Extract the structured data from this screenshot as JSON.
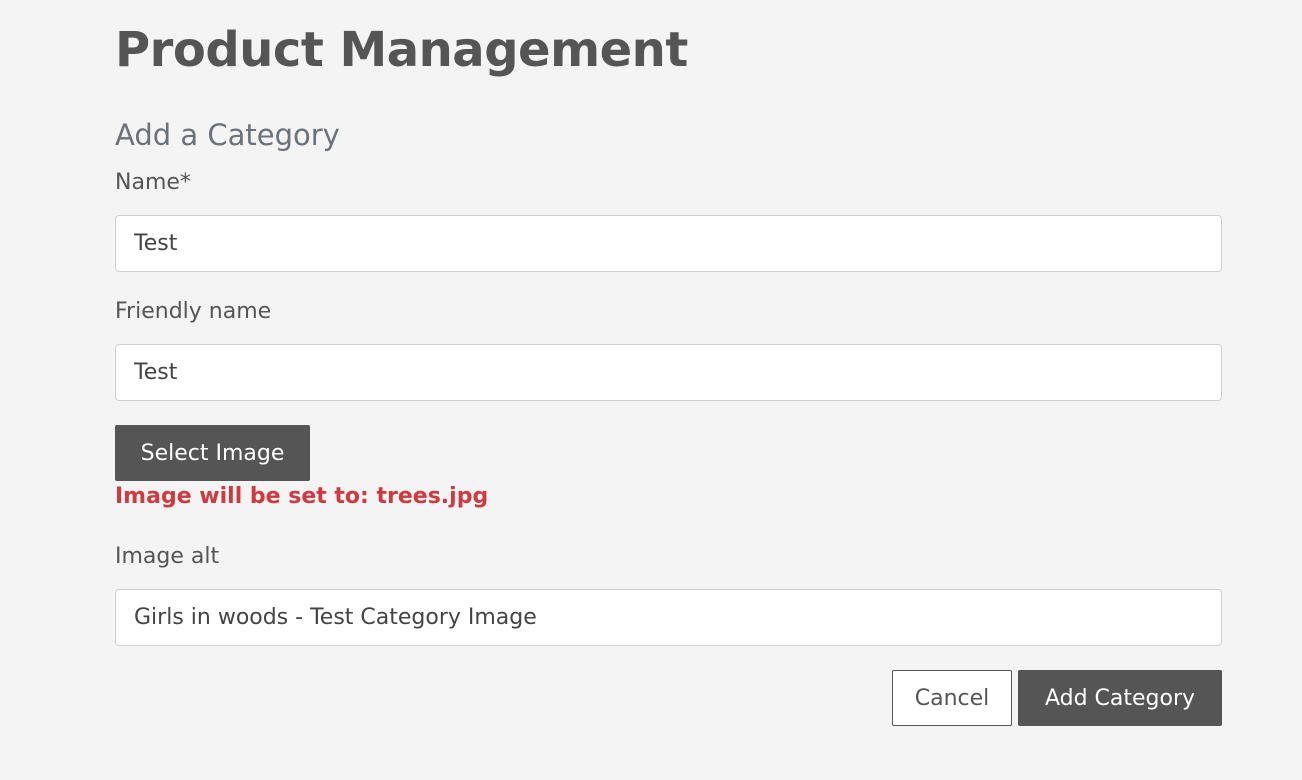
{
  "page": {
    "title": "Product Management",
    "section_title": "Add a Category"
  },
  "form": {
    "name": {
      "label": "Name*",
      "value": "Test"
    },
    "friendly_name": {
      "label": "Friendly name",
      "value": "Test"
    },
    "select_image_label": "Select Image",
    "image_note": "Image will be set to: trees.jpg",
    "image_alt": {
      "label": "Image alt",
      "value": "Girls in woods - Test Category Image"
    },
    "cancel_label": "Cancel",
    "submit_label": "Add Category"
  },
  "colors": {
    "background": "#f4f4f4",
    "primary_button": "#555555",
    "note_text": "#d0393f",
    "section_title": "#6c727a"
  }
}
